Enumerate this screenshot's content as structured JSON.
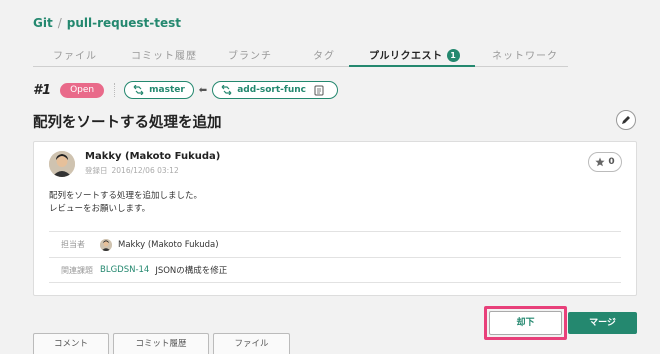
{
  "breadcrumb": {
    "project": "Git",
    "separator": "/",
    "repo": "pull-request-test"
  },
  "tabs": [
    {
      "label": "ファイル"
    },
    {
      "label": "コミット履歴"
    },
    {
      "label": "ブランチ"
    },
    {
      "label": "タグ"
    },
    {
      "label": "プルリクエスト",
      "badge": "1",
      "active": true
    },
    {
      "label": "ネットワーク"
    }
  ],
  "pr": {
    "number": "#1",
    "status": "Open",
    "target_branch": "master",
    "source_branch": "add-sort-func",
    "title": "配列をソートする処理を追加"
  },
  "comment": {
    "author": "Makky (Makoto Fukuda)",
    "meta_label": "登録日",
    "date": "2016/12/06 03:12",
    "star_count": "0",
    "body_line1": "配列をソートする処理を追加しました。",
    "body_line2": "レビューをお願いします。"
  },
  "properties": {
    "assignee_label": "担当者",
    "assignee": "Makky (Makoto Fukuda)",
    "related_label": "関連課題",
    "issue_key": "BLGDSN-14",
    "issue_title": "JSONの構成を修正"
  },
  "actions": {
    "reject": "却下",
    "merge": "マージ"
  },
  "bottom_tabs": [
    "コメント",
    "コミット履歴",
    "ファイル"
  ],
  "colors": {
    "accent": "#24886f",
    "open_status": "#e96a8a",
    "highlight": "#e8407a"
  }
}
